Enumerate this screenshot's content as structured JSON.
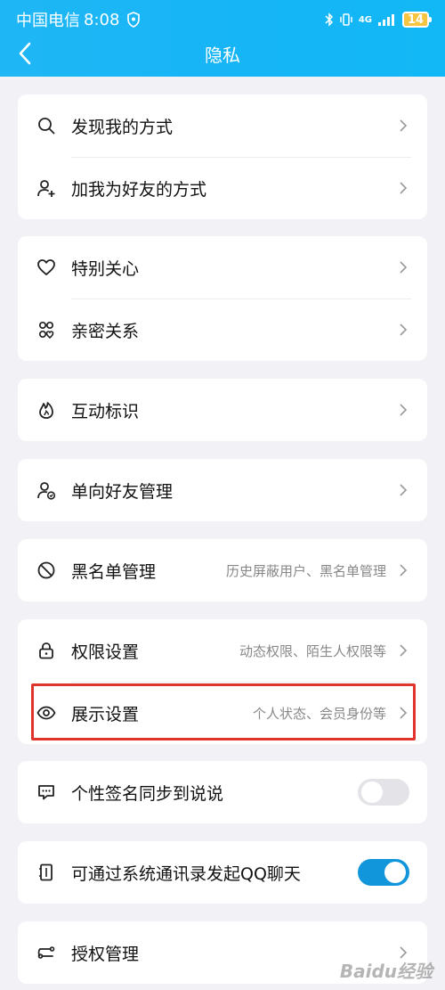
{
  "status_bar": {
    "carrier": "中国电信",
    "time": "8:08",
    "network": "4G",
    "battery": "14"
  },
  "nav": {
    "title": "隐私"
  },
  "groups": [
    {
      "items": [
        {
          "label": "发现我的方式",
          "icon": "search-icon"
        },
        {
          "label": "加我为好友的方式",
          "icon": "add-user-icon"
        }
      ]
    },
    {
      "items": [
        {
          "label": "特别关心",
          "icon": "heart-icon"
        },
        {
          "label": "亲密关系",
          "icon": "intimate-relation-icon"
        }
      ]
    },
    {
      "items": [
        {
          "label": "互动标识",
          "icon": "flame-icon"
        }
      ]
    },
    {
      "items": [
        {
          "label": "单向好友管理",
          "icon": "one-way-friend-icon"
        }
      ]
    },
    {
      "items": [
        {
          "label": "黑名单管理",
          "desc": "历史屏蔽用户、黑名单管理",
          "icon": "block-icon"
        }
      ]
    },
    {
      "items": [
        {
          "label": "权限设置",
          "desc": "动态权限、陌生人权限等",
          "icon": "lock-icon"
        },
        {
          "label": "展示设置",
          "desc": "个人状态、会员身份等",
          "icon": "eye-icon"
        }
      ]
    },
    {
      "items": [
        {
          "label": "个性签名同步到说说",
          "icon": "chat-bubble-icon",
          "toggle": false
        }
      ]
    },
    {
      "items": [
        {
          "label": "可通过系统通讯录发起QQ聊天",
          "icon": "contacts-icon",
          "toggle": true
        }
      ]
    },
    {
      "items": [
        {
          "label": "授权管理",
          "icon": "authorization-icon"
        }
      ]
    }
  ],
  "colors": {
    "header": "#16b5f6",
    "toggle_on": "#1296db",
    "highlight": "#e0332b"
  },
  "watermark": "Baidu经验"
}
